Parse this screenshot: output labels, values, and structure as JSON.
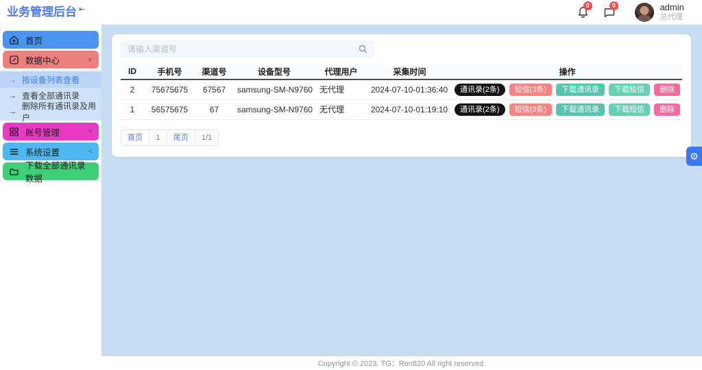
{
  "colors": {
    "brand_blue": "#4a7cfa",
    "menu_home": "#4b93f0",
    "menu_data_center": "#ef7f7f",
    "menu_account": "#e83bc3",
    "menu_settings": "#4db8f0",
    "menu_download": "#3fd077",
    "submenu_bg": "#cfe2f8",
    "submenu_active_bg": "#bcd4f6",
    "main_bg": "#c7ddf2",
    "badge_red": "#fb4b4b",
    "btn_contacts": "#141414",
    "btn_sms": "#f88383",
    "btn_dl_contacts": "#55c6ad",
    "btn_dl_sms": "#67cfb4",
    "btn_delete": "#f76b9c",
    "gear_btn": "#3b76f6"
  },
  "header": {
    "brand": "业务管理后台",
    "collapse_glyph": "⇤",
    "bell_badge": "0",
    "message_badge": "0",
    "user": {
      "name": "admin",
      "role": "总代理"
    }
  },
  "sidebar": {
    "menu": [
      {
        "label": "首页"
      },
      {
        "label": "数据中心",
        "chevron": "∨"
      },
      {
        "label": "账号管理",
        "chevron": "<"
      },
      {
        "label": "系统设置",
        "chevron": "<"
      },
      {
        "label": "下载全部通讯录数据"
      }
    ],
    "submenu": [
      {
        "arrow": "→",
        "label": "按设备列表查看"
      },
      {
        "arrow": "→",
        "label": "查看全部通讯录"
      },
      {
        "arrow": "→",
        "label": "删除所有通讯录及用户"
      }
    ]
  },
  "content": {
    "search": {
      "placeholder": "请输入渠道号"
    },
    "table": {
      "headers": [
        "ID",
        "手机号",
        "渠道号",
        "设备型号",
        "代理用户",
        "采集时间",
        "操作"
      ],
      "rows": [
        {
          "id": "2",
          "phone": "75675675",
          "channel": "67567",
          "device": "samsung-SM-N9760",
          "agent": "无代理",
          "time": "2024-07-10-01:36:40"
        },
        {
          "id": "1",
          "phone": "56575675",
          "channel": "67",
          "device": "samsung-SM-N9760",
          "agent": "无代理",
          "time": "2024-07-10-01:19:10"
        }
      ],
      "actions": [
        "通讯录(2条)",
        "短信(3条)",
        "下载通讯录",
        "下载短信",
        "删除"
      ]
    },
    "pagination": {
      "first": "首页",
      "page": "1",
      "last": "尾页",
      "indicator": "1/1"
    }
  },
  "footer": {
    "copyright": "Copyright © 2023. TG：Ron820 All right reserved."
  },
  "side_widget": {
    "gear_glyph": "⚙"
  }
}
